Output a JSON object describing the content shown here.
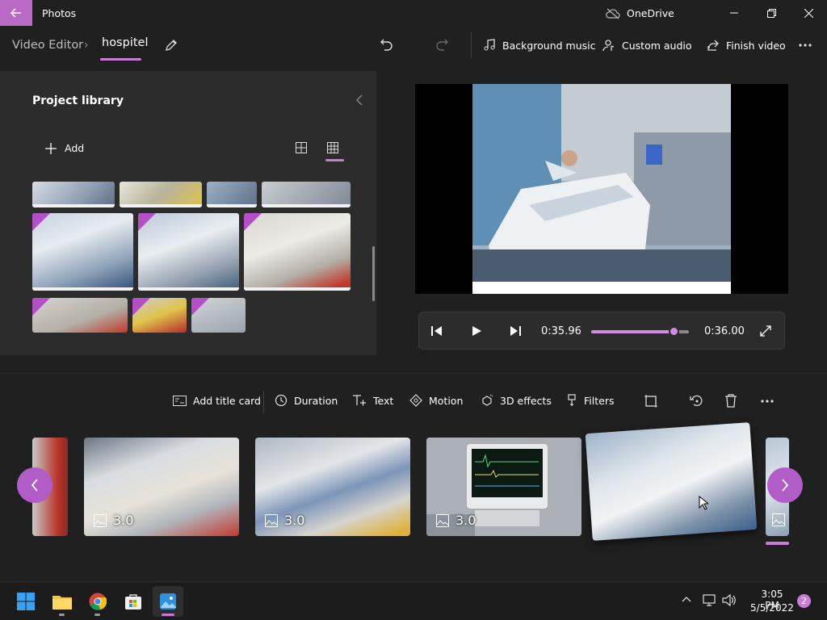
{
  "titlebar": {
    "app_name": "Photos",
    "onedrive_label": "OneDrive"
  },
  "breadcrumb": {
    "root": "Video Editor",
    "project_name": "hospitel"
  },
  "toolbar": {
    "background_music": "Background music",
    "custom_audio": "Custom audio",
    "finish_video": "Finish video"
  },
  "library": {
    "title": "Project library",
    "add_label": "Add"
  },
  "player": {
    "current_time": "0:35.96",
    "total_time": "0:36.00",
    "progress": 0.84
  },
  "storyboard": {
    "tools": {
      "add_title_card": "Add title card",
      "duration": "Duration",
      "text": "Text",
      "motion": "Motion",
      "effects_3d": "3D effects",
      "filters": "Filters"
    },
    "clips": [
      {
        "duration": "3.0"
      },
      {
        "duration": "3.0"
      },
      {
        "duration": "3.0"
      }
    ]
  },
  "taskbar": {
    "time": "3:05 PM",
    "date": "5/5/2022",
    "notification_count": "2"
  },
  "colors": {
    "accent": "#c77dd6",
    "background": "#202020",
    "panel": "#2c2c2c"
  }
}
